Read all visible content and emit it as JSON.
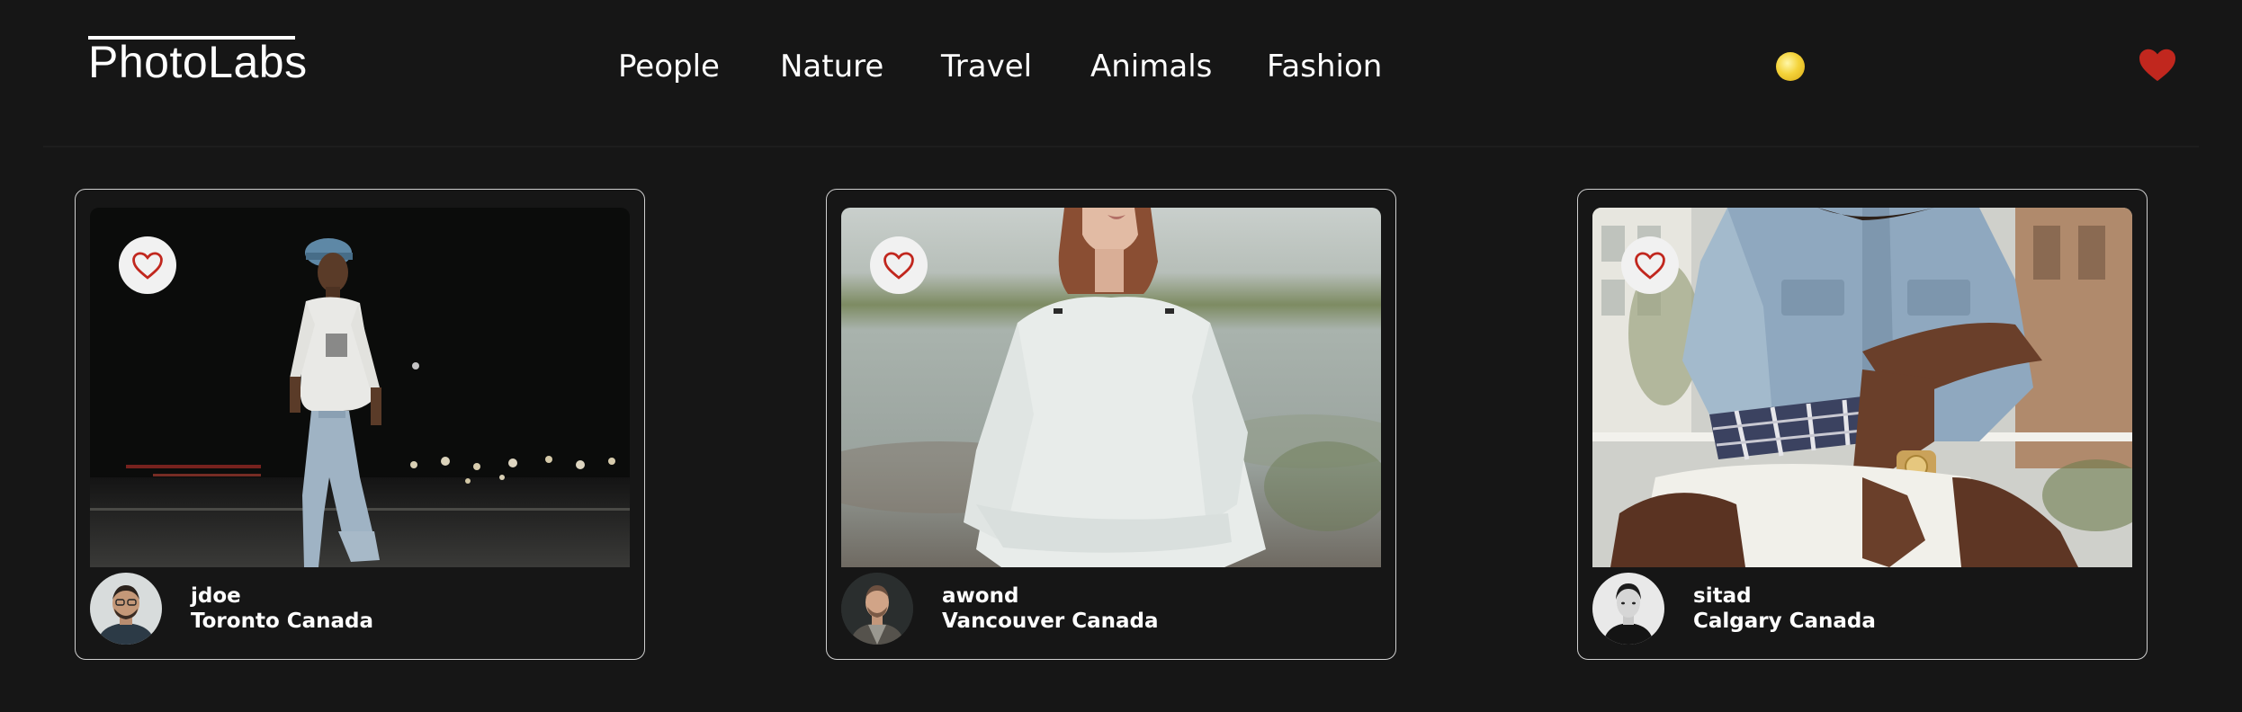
{
  "header": {
    "logo": "PhotoLabs",
    "nav": [
      "People",
      "Nature",
      "Travel",
      "Animals",
      "Fashion"
    ]
  },
  "colors": {
    "background": "#161616",
    "heart": "#c1271e",
    "notification_dot": "#f4d33a",
    "card_border": "#cfcfcf"
  },
  "photos": [
    {
      "username": "jdoe",
      "location": "Toronto Canada",
      "liked": false
    },
    {
      "username": "awond",
      "location": "Vancouver Canada",
      "liked": false
    },
    {
      "username": "sitad",
      "location": "Calgary Canada",
      "liked": false
    }
  ],
  "icons": {
    "like": "heart-outline-icon",
    "favorites": "heart-filled-icon",
    "notification": "notification-dot-icon"
  }
}
